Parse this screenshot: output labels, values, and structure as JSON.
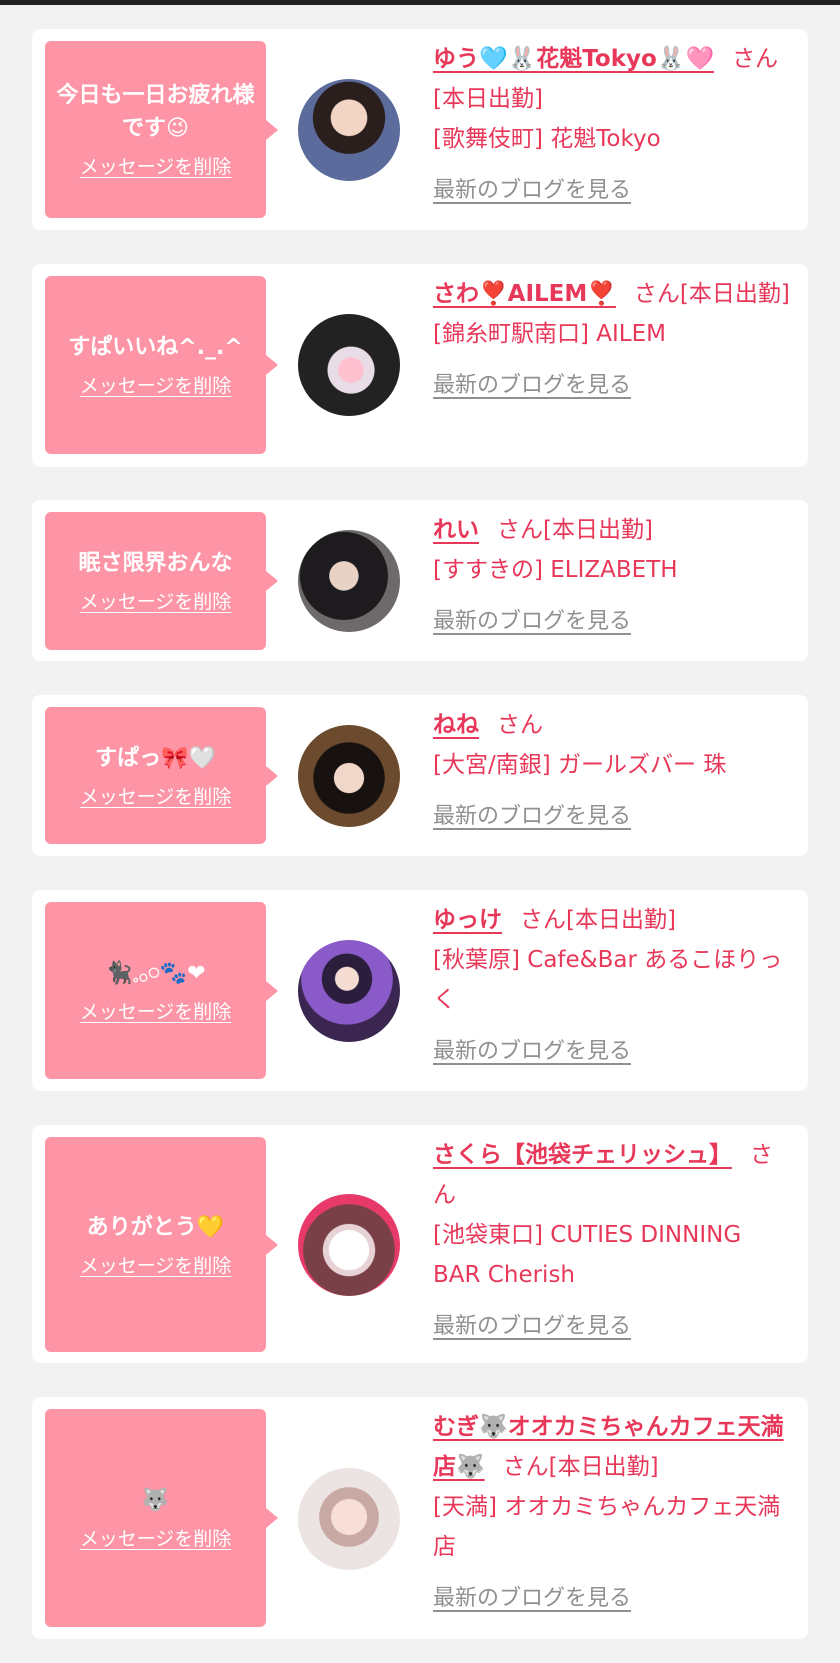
{
  "delete_label": "メッセージを削除",
  "blog_label": "最新のブログを見る",
  "cards": [
    {
      "message": "今日も一日お疲れ様です😉",
      "name": "ゆう🩵🐰花魁Tokyo🐰🩷",
      "suffix": "さん[本日出勤]",
      "shop": "[歌舞伎町] 花魁Tokyo"
    },
    {
      "message": "すぱいいね^._.^",
      "name": "さわ❣️AILEM❣️",
      "suffix": "さん[本日出勤]",
      "shop": "[錦糸町駅南口] AILEM"
    },
    {
      "message": "眠さ限界おんな",
      "name": "れい",
      "suffix": "さん[本日出勤]",
      "shop": "[すすきの] ELIZABETH"
    },
    {
      "message": "すぱっ🎀🤍",
      "name": "ねね",
      "suffix": "さん",
      "shop": "[大宮/南銀] ガールズバー 珠"
    },
    {
      "message": "🐈‍⬛𓈒𓂂𓏸🐾❤",
      "name": "ゆっけ",
      "suffix": "さん[本日出勤]",
      "shop": "[秋葉原] Cafe&Bar あるこほりっく"
    },
    {
      "message": "ありがとう💛",
      "name": "さくら【池袋チェリッシュ】",
      "suffix": "さん",
      "shop": "[池袋東口] CUTIES DINNING BAR Cherish"
    },
    {
      "message": "🐺",
      "name": "むぎ🐺オオカミちゃんカフェ天満店🐺",
      "suffix": "さん[本日出勤]",
      "shop": "[天満] オオカミちゃんカフェ天満店"
    }
  ],
  "colors": {
    "bubble": "#fe95a6",
    "accent": "#e8385a",
    "muted": "#909090",
    "background": "#f2f2f2"
  }
}
